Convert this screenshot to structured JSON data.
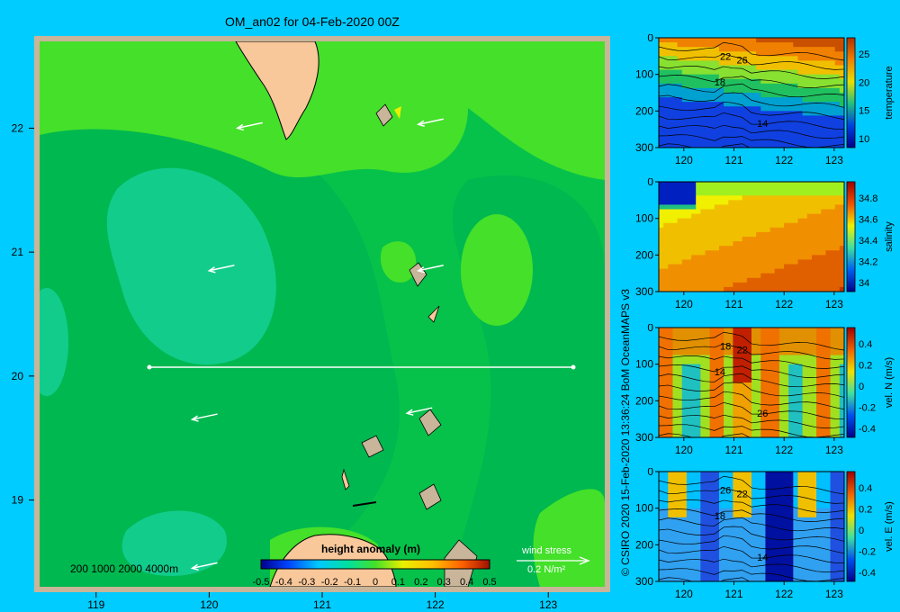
{
  "title": "OM_an02 for 04-Feb-2020 00Z",
  "credit": "© CSIRO 2020  15-Feb-2020 13:36:24 BoM OceanMAPS v3",
  "map": {
    "lon_ticks": [
      "119",
      "120",
      "121",
      "122",
      "123"
    ],
    "lat_ticks": [
      "22",
      "21",
      "20",
      "19"
    ],
    "depth_legend": "200  1000  2000  4000m",
    "colorbar_title": "height anomaly  (m)",
    "colorbar_ticks": [
      "-0.5",
      "-0.4",
      "-0.3",
      "-0.2",
      "-0.1",
      "0",
      "0.1",
      "0.2",
      "0.3",
      "0.4",
      "0.5"
    ],
    "wind_label": "wind stress",
    "wind_scale": "0.2 N/m²",
    "colors": {
      "land": "#f8c79a",
      "frame": "#c8b59a",
      "dark": "#06c24a",
      "mid": "#00b850",
      "light": "#12cc8c",
      "lime": "#44e02a"
    }
  },
  "chart_data": [
    {
      "type": "heatmap",
      "title": "OM_an02 for 04-Feb-2020 00Z",
      "variable": "height anomaly (m)",
      "xlim": [
        118.5,
        123.5
      ],
      "ylim": [
        18.3,
        22.7
      ],
      "clim": [
        -0.5,
        0.5
      ],
      "section_line": {
        "lat": 20,
        "lon": [
          119.5,
          123.2
        ]
      },
      "wind_vectors": [
        {
          "lon": 120.25,
          "lat": 22.0
        },
        {
          "lon": 121.85,
          "lat": 22.03
        },
        {
          "lon": 120.0,
          "lat": 20.85
        },
        {
          "lon": 121.85,
          "lat": 20.85
        },
        {
          "lon": 119.85,
          "lat": 19.65
        },
        {
          "lon": 121.75,
          "lat": 19.7
        },
        {
          "lon": 119.85,
          "lat": 18.45
        }
      ]
    },
    {
      "type": "heatmap",
      "ylabel": "temperature",
      "xlim": [
        119.5,
        123.2
      ],
      "ylim": [
        300,
        0
      ],
      "x_ticks": [
        "120",
        "121",
        "122",
        "123"
      ],
      "y_ticks": [
        "0",
        "100",
        "200",
        "300"
      ],
      "cb_ticks": [
        "25",
        "20",
        "15",
        "10"
      ],
      "contour_labels": [
        "26",
        "22",
        "18",
        "14"
      ]
    },
    {
      "type": "heatmap",
      "ylabel": "salinity",
      "xlim": [
        119.5,
        123.2
      ],
      "ylim": [
        300,
        0
      ],
      "x_ticks": [
        "120",
        "121",
        "122",
        "123"
      ],
      "y_ticks": [
        "0",
        "100",
        "200",
        "300"
      ],
      "cb_ticks": [
        "34.8",
        "34.6",
        "34.4",
        "34.2",
        "34"
      ],
      "contour_labels": []
    },
    {
      "type": "heatmap",
      "ylabel": "vel. N (m/s)",
      "xlim": [
        119.5,
        123.2
      ],
      "ylim": [
        300,
        0
      ],
      "x_ticks": [
        "120",
        "121",
        "122",
        "123"
      ],
      "y_ticks": [
        "0",
        "100",
        "200",
        "300"
      ],
      "cb_ticks": [
        "0.4",
        "0.2",
        "0",
        "-0.2",
        "-0.4"
      ],
      "contour_labels": [
        "22",
        "18",
        "14",
        "26"
      ]
    },
    {
      "type": "heatmap",
      "ylabel": "vel. E (m/s)",
      "xlim": [
        119.5,
        123.2
      ],
      "ylim": [
        300,
        0
      ],
      "x_ticks": [
        "120",
        "121",
        "122",
        "123"
      ],
      "y_ticks": [
        "0",
        "100",
        "200",
        "300"
      ],
      "cb_ticks": [
        "0.4",
        "0.2",
        "0",
        "-0.2",
        "-0.4"
      ],
      "contour_labels": [
        "22",
        "26",
        "18",
        "14"
      ]
    }
  ]
}
